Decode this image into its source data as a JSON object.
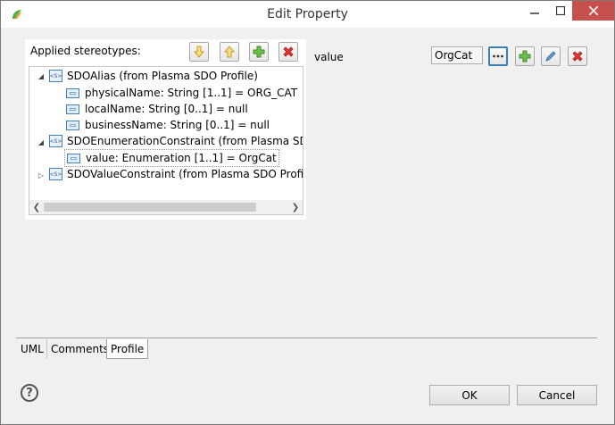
{
  "window": {
    "title": "Edit Property"
  },
  "stereotypes": {
    "label": "Applied stereotypes:",
    "tree": [
      {
        "text": "SDOAlias    (from Plasma SDO Profile)"
      },
      {
        "text": "physicalName: String [1..1] = ORG_CAT"
      },
      {
        "text": "localName: String [0..1] = null"
      },
      {
        "text": "businessName: String [0..1] = null"
      },
      {
        "text": "SDOEnumerationConstraint    (from Plasma SDO"
      },
      {
        "text": "value: Enumeration [1..1] = OrgCat"
      },
      {
        "text": "SDOValueConstraint    (from Plasma SDO Profile)"
      }
    ]
  },
  "value_editor": {
    "label": "value",
    "value": "OrgCat"
  },
  "tabs": [
    {
      "label": "UML"
    },
    {
      "label": "Comments"
    },
    {
      "label": "Profile"
    }
  ],
  "buttons": {
    "ok": "OK",
    "cancel": "Cancel"
  },
  "icon_glyphs": {
    "stereotype": "<S>"
  }
}
